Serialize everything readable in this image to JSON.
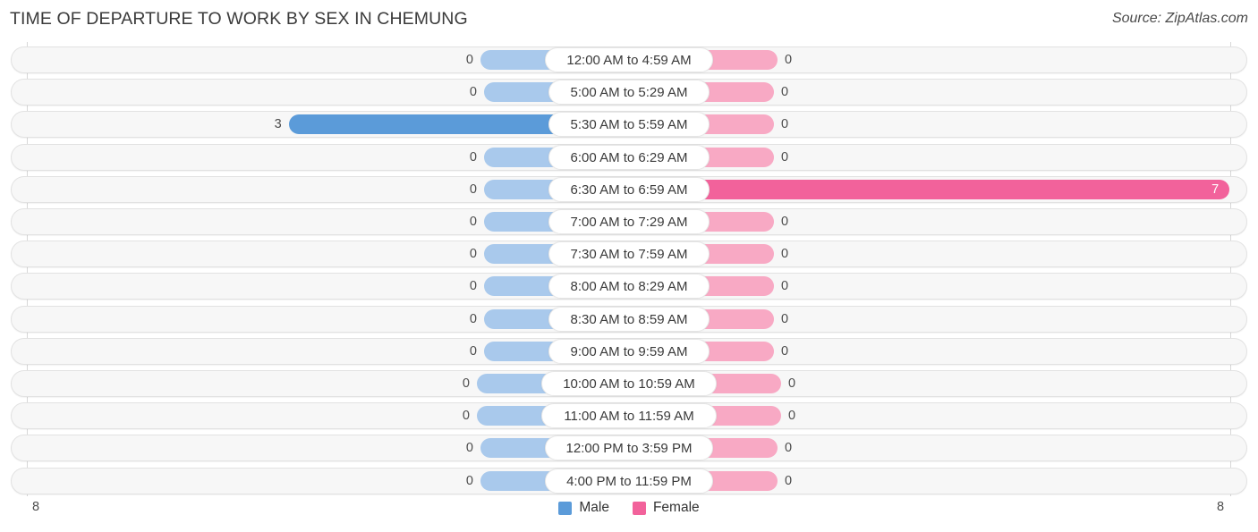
{
  "header": {
    "title": "TIME OF DEPARTURE TO WORK BY SEX IN CHEMUNG",
    "source": "Source: ZipAtlas.com"
  },
  "legend": {
    "items": [
      {
        "label": "Male",
        "color": "#5b9bd9"
      },
      {
        "label": "Female",
        "color": "#f2629b"
      }
    ]
  },
  "axis": {
    "left_end": "8",
    "right_end": "8"
  },
  "colors": {
    "male_light": "#a9c9ec",
    "male_strong": "#5b9bd9",
    "female_light": "#f8a9c4",
    "female_strong": "#f2629b",
    "row_track": "#f7f7f7",
    "row_border": "#e2e2e2",
    "gridline": "#d8d8d8"
  },
  "chart_data": {
    "type": "bar",
    "subtype": "diverging-bar",
    "title": "TIME OF DEPARTURE TO WORK BY SEX IN CHEMUNG",
    "xlabel": "",
    "ylabel": "",
    "xlim": [
      8,
      8
    ],
    "grid": true,
    "legend_position": "bottom-center",
    "categories": [
      "12:00 AM to 4:59 AM",
      "5:00 AM to 5:29 AM",
      "5:30 AM to 5:59 AM",
      "6:00 AM to 6:29 AM",
      "6:30 AM to 6:59 AM",
      "7:00 AM to 7:29 AM",
      "7:30 AM to 7:59 AM",
      "8:00 AM to 8:29 AM",
      "8:30 AM to 8:59 AM",
      "9:00 AM to 9:59 AM",
      "10:00 AM to 10:59 AM",
      "11:00 AM to 11:59 AM",
      "12:00 PM to 3:59 PM",
      "4:00 PM to 11:59 PM"
    ],
    "series": [
      {
        "name": "Male",
        "color": "#5b9bd9",
        "values": [
          0,
          0,
          3,
          0,
          0,
          0,
          0,
          0,
          0,
          0,
          0,
          0,
          0,
          0
        ]
      },
      {
        "name": "Female",
        "color": "#f2629b",
        "values": [
          0,
          0,
          0,
          0,
          7,
          0,
          0,
          0,
          0,
          0,
          0,
          0,
          0,
          0
        ]
      }
    ]
  }
}
